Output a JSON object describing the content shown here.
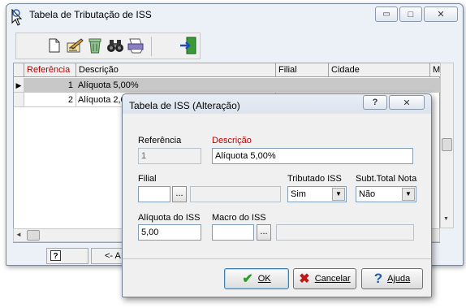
{
  "main_window": {
    "title": "Tabela de Tributação de ISS",
    "minimize_glyph": "▭",
    "maximize_glyph": "□",
    "close_glyph": "✕",
    "toolbar_icons": [
      "new-document-icon",
      "edit-icon",
      "delete-trash-icon",
      "binoculars-search-icon",
      "print-icon",
      "exit-door-icon"
    ],
    "grid": {
      "columns": [
        "Referência",
        "Descrição",
        "Filial",
        "Cidade",
        "M"
      ],
      "rows": [
        {
          "referencia": "1",
          "descricao": "Alíquota 5,00%"
        },
        {
          "referencia": "2",
          "descricao": "Alíquota 2,0"
        }
      ]
    },
    "status_help_glyph": "?",
    "status_nav_text": "<- A"
  },
  "dialog": {
    "title": "Tabela de ISS (Alteração)",
    "help_glyph": "?",
    "close_glyph": "✕",
    "referencia_label": "Referência",
    "referencia_value": "1",
    "descricao_label": "Descrição",
    "descricao_value": "Alíquota 5,00%",
    "filial_label": "Filial",
    "filial_value": "",
    "filial_lookup_glyph": "...",
    "filial_name": "",
    "tributado_label": "Tributado ISS",
    "tributado_value": "Sim",
    "subtotal_label": "Subt.Total Nota",
    "subtotal_value": "Não",
    "aliquota_label": "Alíquota do ISS",
    "aliquota_value": "5,00",
    "macro_label": "Macro do ISS",
    "macro_value": "",
    "macro_lookup_glyph": "...",
    "macro_name": "",
    "ok_label": "OK",
    "cancel_label": "Cancelar",
    "help_label": "Ajuda",
    "colors": {
      "required_label": "#c00000",
      "ok_check": "#2a9d2a",
      "cancel_x": "#c01818",
      "help_q": "#1a5fb4"
    }
  }
}
